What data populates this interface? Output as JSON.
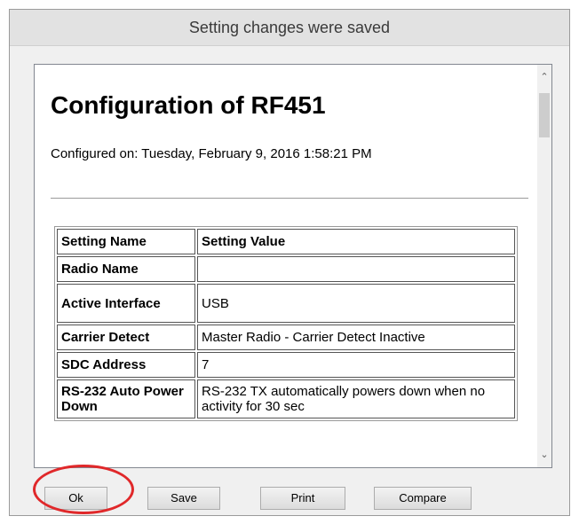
{
  "window": {
    "title": "Setting changes were saved"
  },
  "report": {
    "heading": "Configuration of RF451",
    "configured_on": "Configured on: Tuesday, February 9, 2016 1:58:21 PM",
    "table": {
      "headers": [
        "Setting Name",
        "Setting Value"
      ],
      "rows": [
        [
          "Radio Name",
          ""
        ],
        [
          "Active Interface",
          "USB"
        ],
        [
          "Carrier Detect",
          "Master Radio - Carrier Detect Inactive"
        ],
        [
          "SDC Address",
          "7"
        ],
        [
          "RS-232 Auto Power Down",
          "RS-232 TX automatically powers down when no activity for 30 sec"
        ]
      ]
    }
  },
  "buttons": {
    "ok": "Ok",
    "save": "Save",
    "print": "Print",
    "compare": "Compare"
  },
  "icons": {
    "scroll_up": "scroll-up-arrow-icon",
    "scroll_down": "scroll-down-arrow-icon"
  },
  "colors": {
    "highlight": "#e0282a",
    "titlebar": "#e2e2e2"
  }
}
